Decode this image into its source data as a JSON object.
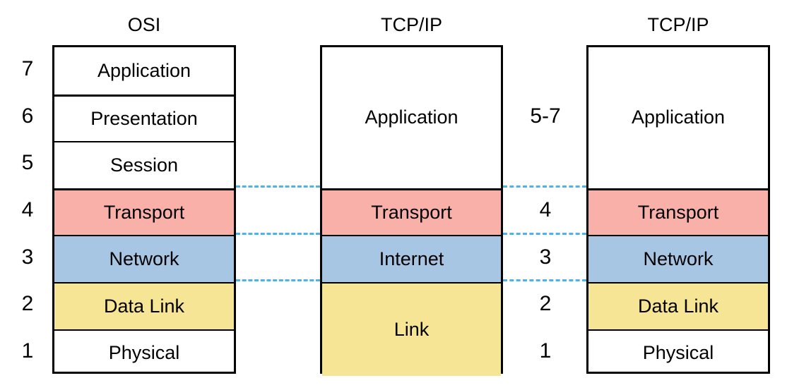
{
  "diagram": {
    "title_osi": "OSI",
    "title_tcpip_mid": "TCP/IP",
    "title_tcpip_right": "TCP/IP",
    "colors": {
      "transport_fill": "#F8B0A8",
      "network_fill": "#A6C6E4",
      "datalink_fill": "#F7E596",
      "plain_fill": "#FFFFFF",
      "border": "#000000",
      "connector": "#4FB3E8"
    }
  },
  "osi": {
    "heading": "OSI",
    "numbers": [
      "7",
      "6",
      "5",
      "4",
      "3",
      "2",
      "1"
    ],
    "layers": [
      {
        "number": "7",
        "label": "Application",
        "fill": "#FFFFFF"
      },
      {
        "number": "6",
        "label": "Presentation",
        "fill": "#FFFFFF"
      },
      {
        "number": "5",
        "label": "Session",
        "fill": "#FFFFFF"
      },
      {
        "number": "4",
        "label": "Transport",
        "fill": "#F8B0A8"
      },
      {
        "number": "3",
        "label": "Network",
        "fill": "#A6C6E4"
      },
      {
        "number": "2",
        "label": "Data Link",
        "fill": "#F7E596"
      },
      {
        "number": "1",
        "label": "Physical",
        "fill": "#FFFFFF"
      }
    ]
  },
  "tcpip_middle": {
    "heading": "TCP/IP",
    "layers": [
      {
        "label": "Application",
        "fill": "#FFFFFF",
        "spans": 3
      },
      {
        "label": "Transport",
        "fill": "#F8B0A8",
        "spans": 1
      },
      {
        "label": "Internet",
        "fill": "#A6C6E4",
        "spans": 1
      },
      {
        "label": "Link",
        "fill": "#F7E596",
        "spans": 2
      }
    ]
  },
  "tcpip_right": {
    "heading": "TCP/IP",
    "numbers": [
      "5-7",
      "4",
      "3",
      "2",
      "1"
    ],
    "layers": [
      {
        "number": "5-7",
        "label": "Application",
        "fill": "#FFFFFF",
        "spans": 3
      },
      {
        "number": "4",
        "label": "Transport",
        "fill": "#F8B0A8",
        "spans": 1
      },
      {
        "number": "3",
        "label": "Network",
        "fill": "#A6C6E4",
        "spans": 1
      },
      {
        "number": "2",
        "label": "Data Link",
        "fill": "#F7E596",
        "spans": 1
      },
      {
        "number": "1",
        "label": "Physical",
        "fill": "#FFFFFF",
        "spans": 1
      }
    ]
  },
  "connectors": [
    {
      "name": "transport-alignment"
    },
    {
      "name": "network-alignment"
    },
    {
      "name": "datalink-alignment"
    }
  ]
}
